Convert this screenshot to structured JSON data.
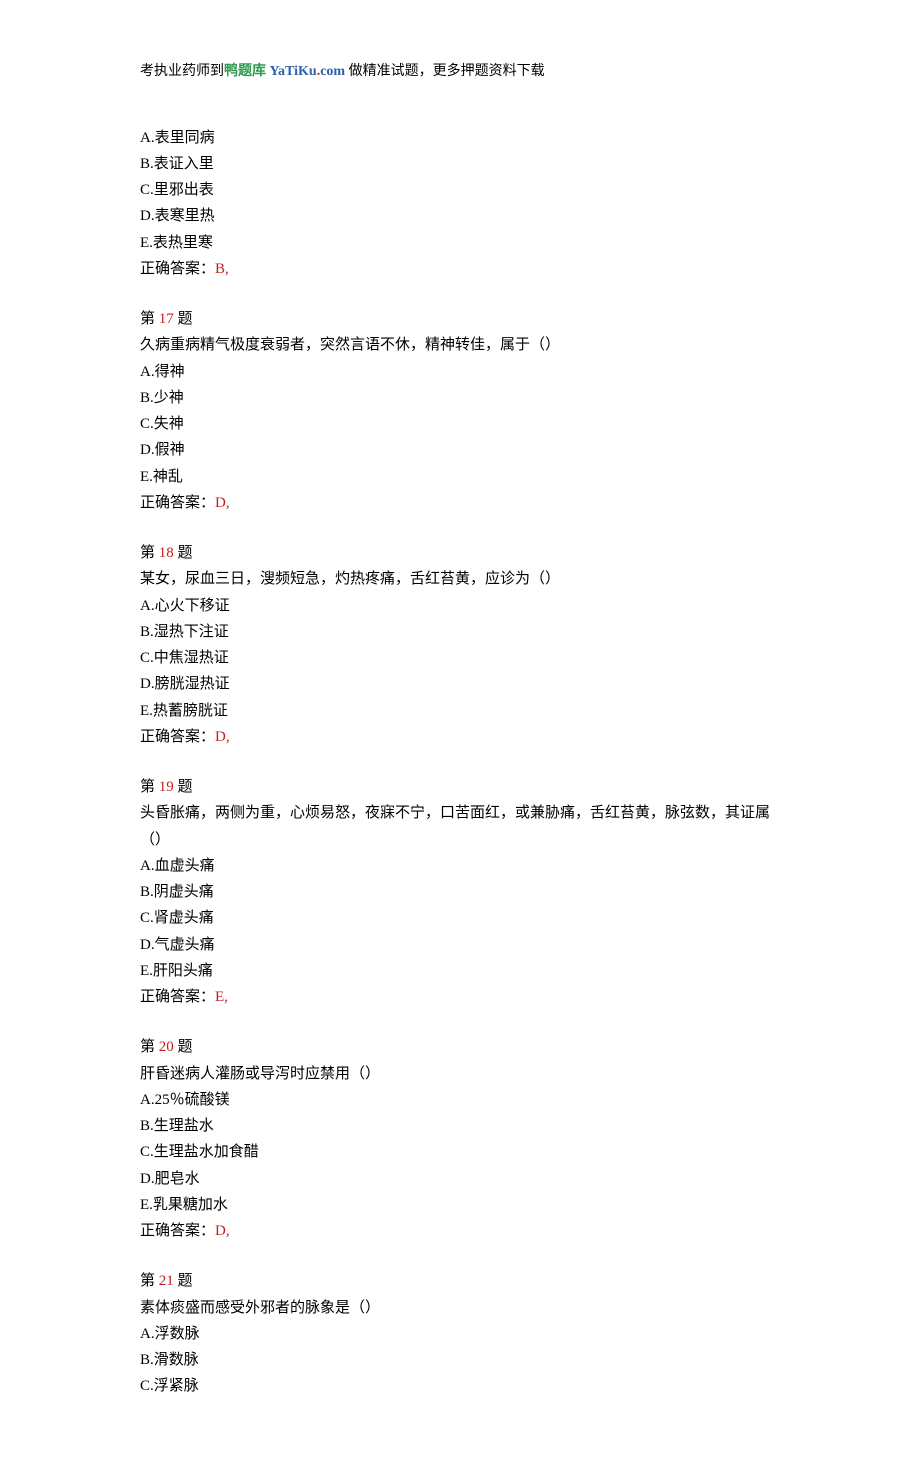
{
  "header": {
    "prefix": "考执业药师到",
    "green": "鸭题库",
    "brand_ya": "YaTiKu",
    "brand_dot": ".",
    "brand_com": "com",
    "suffix": " 做精准试题，更多押题资料下载"
  },
  "q16_partial": {
    "options": [
      "A.表里同病",
      "B.表证入里",
      "C.里邪出表",
      "D.表寒里热",
      "E.表热里寒"
    ],
    "answer_label": "正确答案：",
    "answer": "B,"
  },
  "questions": [
    {
      "label_pre": "第 ",
      "num": "17",
      "label_post": " 题",
      "stem": "久病重病精气极度衰弱者，突然言语不休，精神转佳，属于（）",
      "options": [
        "A.得神",
        "B.少神",
        "C.失神",
        "D.假神",
        "E.神乱"
      ],
      "answer_label": "正确答案：",
      "answer": "D,"
    },
    {
      "label_pre": "第 ",
      "num": "18",
      "label_post": " 题",
      "stem": "某女，尿血三日，溲频短急，灼热疼痛，舌红苔黄，应诊为（）",
      "options": [
        "A.心火下移证",
        "B.湿热下注证",
        "C.中焦湿热证",
        "D.膀胱湿热证",
        "E.热蓄膀胱证"
      ],
      "answer_label": "正确答案：",
      "answer": "D,"
    },
    {
      "label_pre": "第 ",
      "num": "19",
      "label_post": " 题",
      "stem": "头昏胀痛，两侧为重，心烦易怒，夜寐不宁，口苦面红，或兼胁痛，舌红苔黄，脉弦数，其证属（）",
      "options": [
        "A.血虚头痛",
        "B.阴虚头痛",
        "C.肾虚头痛",
        "D.气虚头痛",
        "E.肝阳头痛"
      ],
      "answer_label": "正确答案：",
      "answer": "E,"
    },
    {
      "label_pre": "第 ",
      "num": "20",
      "label_post": " 题",
      "stem": "肝昏迷病人灌肠或导泻时应禁用（）",
      "options": [
        "A.25％硫酸镁",
        "B.生理盐水",
        "C.生理盐水加食醋",
        "D.肥皂水",
        "E.乳果糖加水"
      ],
      "answer_label": "正确答案：",
      "answer": "D,"
    },
    {
      "label_pre": "第 ",
      "num": "21",
      "label_post": " 题",
      "stem": "素体痰盛而感受外邪者的脉象是（）",
      "options": [
        "A.浮数脉",
        "B.滑数脉",
        "C.浮紧脉"
      ],
      "answer_label": "",
      "answer": ""
    }
  ]
}
